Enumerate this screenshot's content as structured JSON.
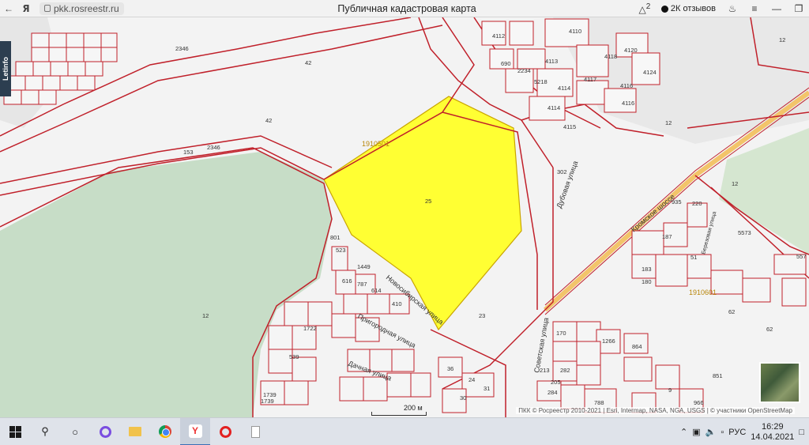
{
  "browser": {
    "url": "pkk.rosreestr.ru",
    "page_title": "Публичная кадастровая карта",
    "reviews_label": "2К отзывов",
    "notification_count": "2"
  },
  "map": {
    "side_badge": "Letinfo",
    "scale_label": "200 м",
    "attribution": "ПКК © Росреестр 2010-2021 | Esri, Intermap, NASA, NGA, USGS | © участники OpenStreetMap",
    "colors": {
      "parcel_line": "#c0202a",
      "highlight": "#ffff33",
      "forest": "#c5dcc5",
      "road": "#f0b040"
    },
    "quarter_labels": [
      "1910501",
      "1910601"
    ],
    "street_labels": [
      "Кромское шоссе",
      "Советская улица",
      "Дубовая улица",
      "Новосибирская улица",
      "Пригородная улица",
      "Дачная улица",
      "Березовая улица"
    ],
    "parcel_labels": [
      "2346",
      "42",
      "42",
      "153",
      "2346",
      "25",
      "23",
      "12",
      "12",
      "12",
      "62",
      "62",
      "851",
      "4110",
      "4118",
      "4112",
      "4117",
      "4114",
      "4114",
      "4116",
      "4116",
      "4115",
      "5218",
      "690",
      "2234",
      "4113",
      "4124",
      "4120",
      "302",
      "935",
      "220",
      "187",
      "51",
      "183",
      "180",
      "1739",
      "539",
      "36",
      "24",
      "31",
      "30",
      "170",
      "864",
      "1266",
      "213",
      "282",
      "205",
      "284",
      "788",
      "9",
      "966",
      "5573",
      "557",
      "12",
      "616",
      "1449",
      "787",
      "614",
      "410",
      "801",
      "523",
      "1722",
      "1739"
    ]
  },
  "taskbar": {
    "language": "РУС",
    "time": "16:29",
    "date": "14.04.2021"
  }
}
